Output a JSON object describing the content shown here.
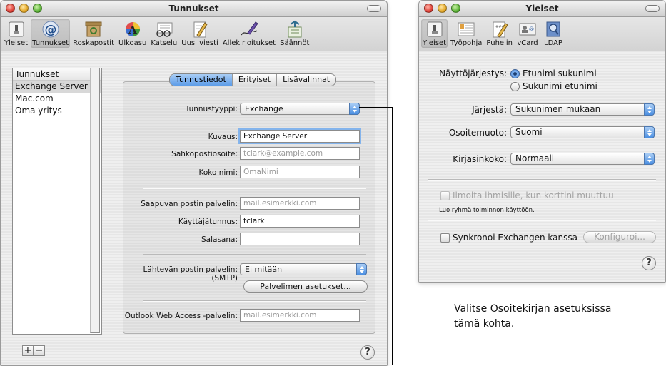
{
  "left_window": {
    "title": "Tunnukset",
    "toolbar": [
      {
        "label": "Yleiset",
        "icon": "general-switch-icon"
      },
      {
        "label": "Tunnukset",
        "icon": "at-sign-icon",
        "selected": true
      },
      {
        "label": "Roskapostit",
        "icon": "junk-mail-icon"
      },
      {
        "label": "Ulkoasu",
        "icon": "fonts-colors-icon"
      },
      {
        "label": "Katselu",
        "icon": "viewing-glasses-icon"
      },
      {
        "label": "Uusi viesti",
        "icon": "compose-pencil-icon"
      },
      {
        "label": "Allekirjoitukset",
        "icon": "signature-pen-icon"
      },
      {
        "label": "Säännöt",
        "icon": "rules-arrows-icon"
      }
    ],
    "accounts": {
      "header": "Tunnukset",
      "items": [
        "Exchange Server",
        "Mac.com",
        "Oma yritys"
      ],
      "selected_index": 0,
      "add_label": "+",
      "remove_label": "−"
    },
    "tabs": [
      "Tunnustiedot",
      "Erityiset",
      "Lisävalinnat"
    ],
    "active_tab": 0,
    "form": {
      "account_type_label": "Tunnustyyppi:",
      "account_type_value": "Exchange",
      "description_label": "Kuvaus:",
      "description_value": "Exchange Server",
      "email_label": "Sähköpostiosoite:",
      "email_placeholder": "tclark@example.com",
      "fullname_label": "Koko nimi:",
      "fullname_placeholder": "OmaNimi",
      "incoming_label": "Saapuvan postin palvelin:",
      "incoming_placeholder": "mail.esimerkki.com",
      "username_label": "Käyttäjätunnus:",
      "username_value": "tclark",
      "password_label": "Salasana:",
      "password_value": "",
      "outgoing_label": "Lähtevän postin palvelin:",
      "outgoing_label_2": "(SMTP)",
      "outgoing_value": "Ei mitään",
      "server_settings_button": "Palvelimen asetukset...",
      "owa_label": "Outlook Web Access -palvelin:",
      "owa_placeholder": "mail.esimerkki.com"
    },
    "help_label": "?"
  },
  "right_window": {
    "title": "Yleiset",
    "toolbar": [
      {
        "label": "Yleiset",
        "icon": "general-switch-icon",
        "selected": true
      },
      {
        "label": "Työpohja",
        "icon": "template-card-icon"
      },
      {
        "label": "Puhelin",
        "icon": "phone-format-icon"
      },
      {
        "label": "vCard",
        "icon": "vcard-icon"
      },
      {
        "label": "LDAP",
        "icon": "ldap-search-icon"
      }
    ],
    "display_order_label": "Näyttöjärjestys:",
    "display_order_options": [
      "Etunimi sukunimi",
      "Sukunimi etunimi"
    ],
    "display_order_selected": 0,
    "sort_label": "Järjestä:",
    "sort_value": "Sukunimen mukaan",
    "address_format_label": "Osoitemuoto:",
    "address_format_value": "Suomi",
    "font_size_label": "Kirjasinkoko:",
    "font_size_value": "Normaali",
    "notify_label": "Ilmoita ihmisille, kun korttini muuttuu",
    "notify_hint": "Luo ryhmä toiminnon käyttöön.",
    "sync_label": "Synkronoi Exchangen kanssa",
    "configure_button": "Konfiguroi...",
    "help_label": "?"
  },
  "callout": {
    "line1": "Valitse Osoitekirjan asetuksissa",
    "line2": "tämä kohta."
  }
}
